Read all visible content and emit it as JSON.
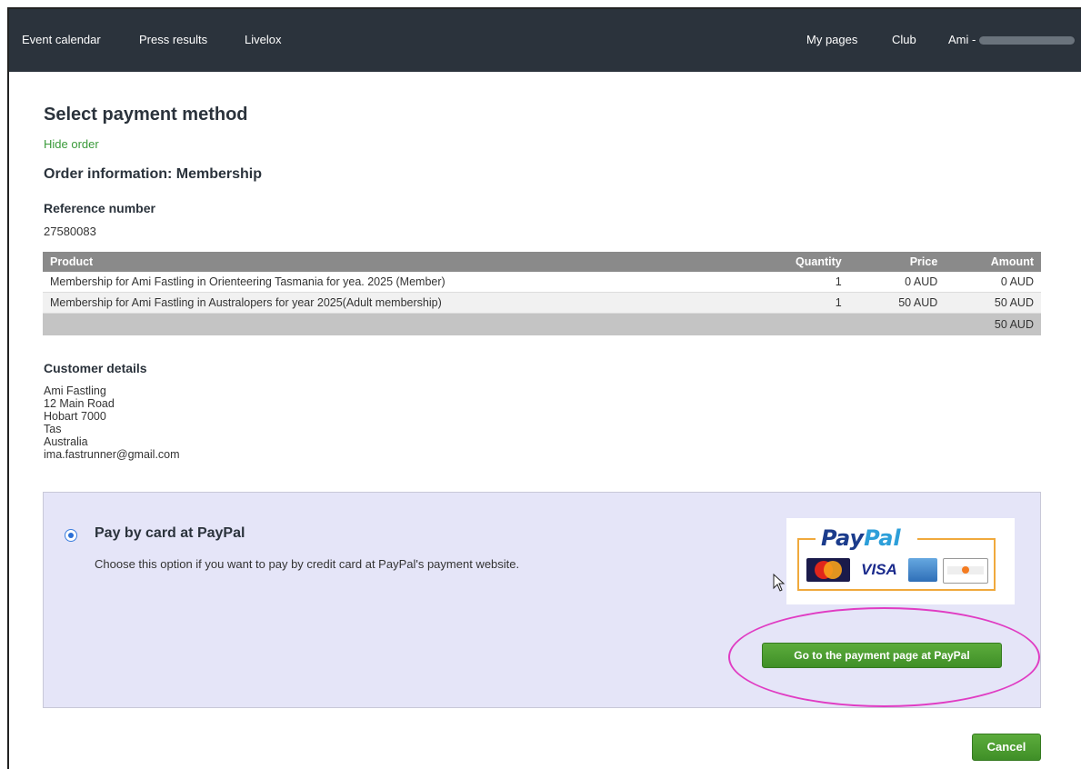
{
  "nav": {
    "event_calendar": "Event calendar",
    "press_results": "Press results",
    "livelox": "Livelox",
    "my_pages": "My pages",
    "club": "Club",
    "user_prefix": "Ami -"
  },
  "page": {
    "title": "Select payment method",
    "hide_order": "Hide order",
    "order_title": "Order information: Membership",
    "reference_label": "Reference number",
    "reference_value": "27580083"
  },
  "order_table": {
    "headers": {
      "product": "Product",
      "quantity": "Quantity",
      "price": "Price",
      "amount": "Amount"
    },
    "rows": [
      {
        "product": "Membership for Ami Fastling in Orienteering Tasmania for yea. 2025 (Member)",
        "quantity": "1",
        "price": "0 AUD",
        "amount": "0 AUD"
      },
      {
        "product": "Membership for Ami Fastling in Australopers for year 2025(Adult membership)",
        "quantity": "1",
        "price": "50 AUD",
        "amount": "50 AUD"
      }
    ],
    "total": "50 AUD"
  },
  "customer": {
    "title": "Customer details",
    "lines": [
      "Ami Fastling",
      "12 Main Road",
      "Hobart 7000",
      "Tas",
      "Australia",
      "ima.fastrunner@gmail.com"
    ]
  },
  "payment": {
    "option_title": "Pay by card at PayPal",
    "option_desc": "Choose this option if you want to pay by credit card at PayPal's payment website.",
    "logo_text_pay": "Pay",
    "logo_text_pal": "Pal",
    "card_visa": "VISA",
    "go_button": "Go to the payment page at PayPal",
    "selected": true
  },
  "cancel_button": "Cancel",
  "colors": {
    "nav_bg": "#2b333c",
    "link_green": "#3a9a3a",
    "button_green": "#4a9a30",
    "panel_bg": "#e5e5f8",
    "highlight": "#e03cc3"
  }
}
